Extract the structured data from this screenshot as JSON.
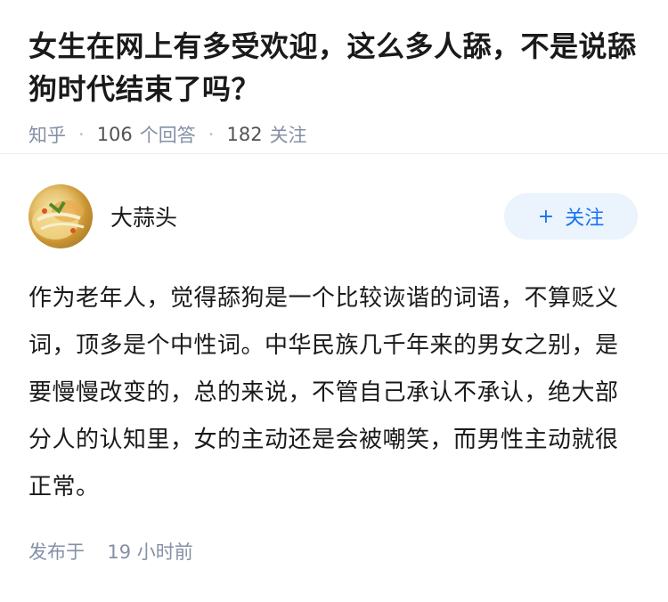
{
  "question": {
    "title": "女生在网上有多受欢迎，这么多人舔，不是说舔狗时代结束了吗？",
    "source": "知乎",
    "answer_count": "106",
    "answer_label": "个回答",
    "follower_count": "182",
    "follower_label": "关注"
  },
  "answer": {
    "author": "大蒜头",
    "follow_label": "关注",
    "follow_icon": "plus-icon",
    "content": "作为老年人，觉得舔狗是一个比较诙谐的词语，不算贬义词，顶多是个中性词。中华民族几千年来的男女之别，是要慢慢改变的，总的来说，不管自己承认不承认，绝大部分人的认知里，女的主动还是会被嘲笑，而男性主动就很正常。",
    "published_label": "发布于",
    "published_time": "19 小时前"
  }
}
